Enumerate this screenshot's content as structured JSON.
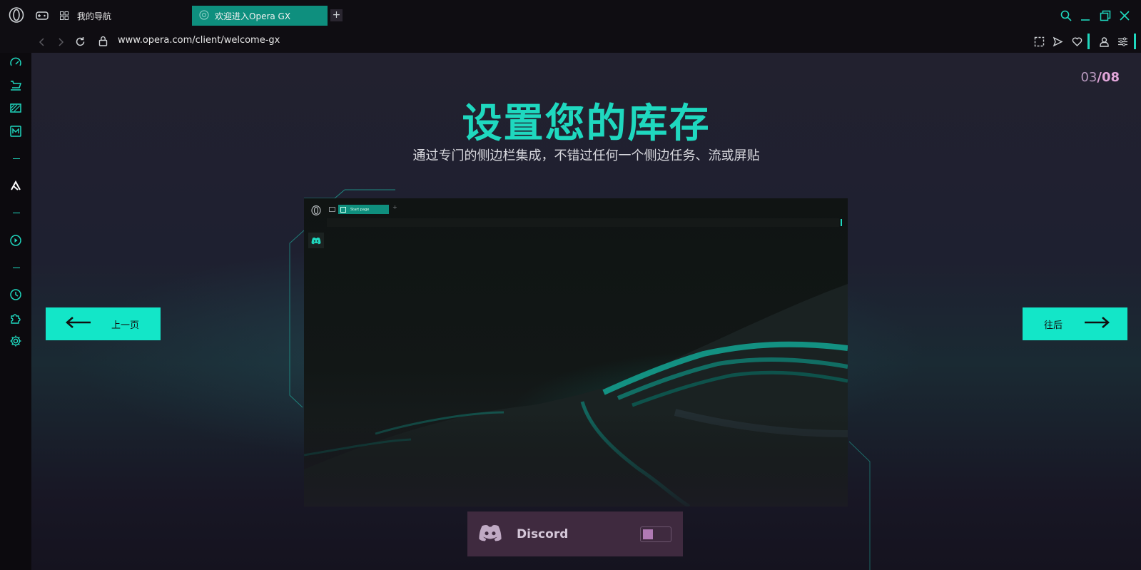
{
  "window": {
    "tabs": [
      {
        "label": "我的导航",
        "active": false
      },
      {
        "label": "欢迎进入Opera GX",
        "active": true
      }
    ],
    "new_tab_symbol": "+"
  },
  "address_bar": {
    "url": "www.opera.com/client/welcome-gx"
  },
  "sidebar": {
    "items": [
      {
        "icon": "speedometer-icon"
      },
      {
        "icon": "shopping-cart-icon"
      },
      {
        "icon": "gx-corner-icon"
      },
      {
        "icon": "mail-m-icon"
      },
      {
        "icon": "pen-tool-icon"
      },
      {
        "icon": "play-circle-icon"
      },
      {
        "icon": "history-clock-icon"
      },
      {
        "icon": "extensions-puzzle-icon"
      },
      {
        "icon": "settings-gear-icon"
      }
    ]
  },
  "page": {
    "pager_current": "03",
    "pager_total": "/08",
    "title": "设置您的库存",
    "subtitle": "通过专门的侧边栏集成，不错过任何一个侧边任务、流或屏贴",
    "prev_label": "上一页",
    "next_label": "往后",
    "mockup": {
      "tab_label": "Start page"
    },
    "integration": {
      "name": "Discord",
      "enabled": false
    }
  },
  "colors": {
    "accent": "#1fd8bf",
    "button": "#13e6c8",
    "pager_highlight": "#e0a5d8",
    "discord_card": "#3f2a3f"
  }
}
